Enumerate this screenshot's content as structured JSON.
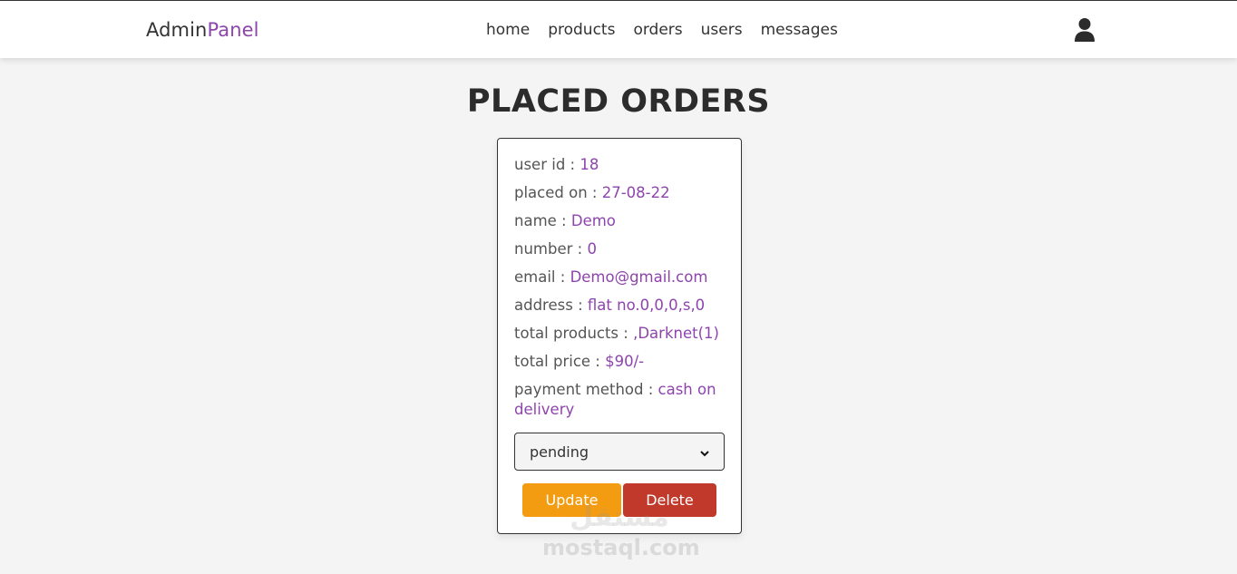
{
  "header": {
    "logo_main": "Admin",
    "logo_accent": "Panel",
    "nav": [
      "home",
      "products",
      "orders",
      "users",
      "messages"
    ],
    "user_icon": "user-icon"
  },
  "page": {
    "title": "PLACED ORDERS"
  },
  "order": {
    "user_id_label": "user id :",
    "user_id": "18",
    "placed_on_label": "placed on :",
    "placed_on": "27-08-22",
    "name_label": "name :",
    "name": "Demo",
    "number_label": "number :",
    "number": "0",
    "email_label": "email :",
    "email": "Demo@gmail.com",
    "address_label": "address :",
    "address": "flat no.0,0,0,s,0",
    "total_products_label": "total products :",
    "total_products": ",Darknet(1)",
    "total_price_label": "total price :",
    "total_price": "$90/-",
    "payment_method_label": "payment method :",
    "payment_method": "cash on delivery",
    "status_selected": "pending",
    "update_label": "Update",
    "delete_label": "Delete"
  },
  "watermark": {
    "arabic": "مستقل",
    "latin": "mostaql.com"
  },
  "colors": {
    "accent": "#8e44ad",
    "update": "#f39c12",
    "delete": "#c0392b"
  }
}
